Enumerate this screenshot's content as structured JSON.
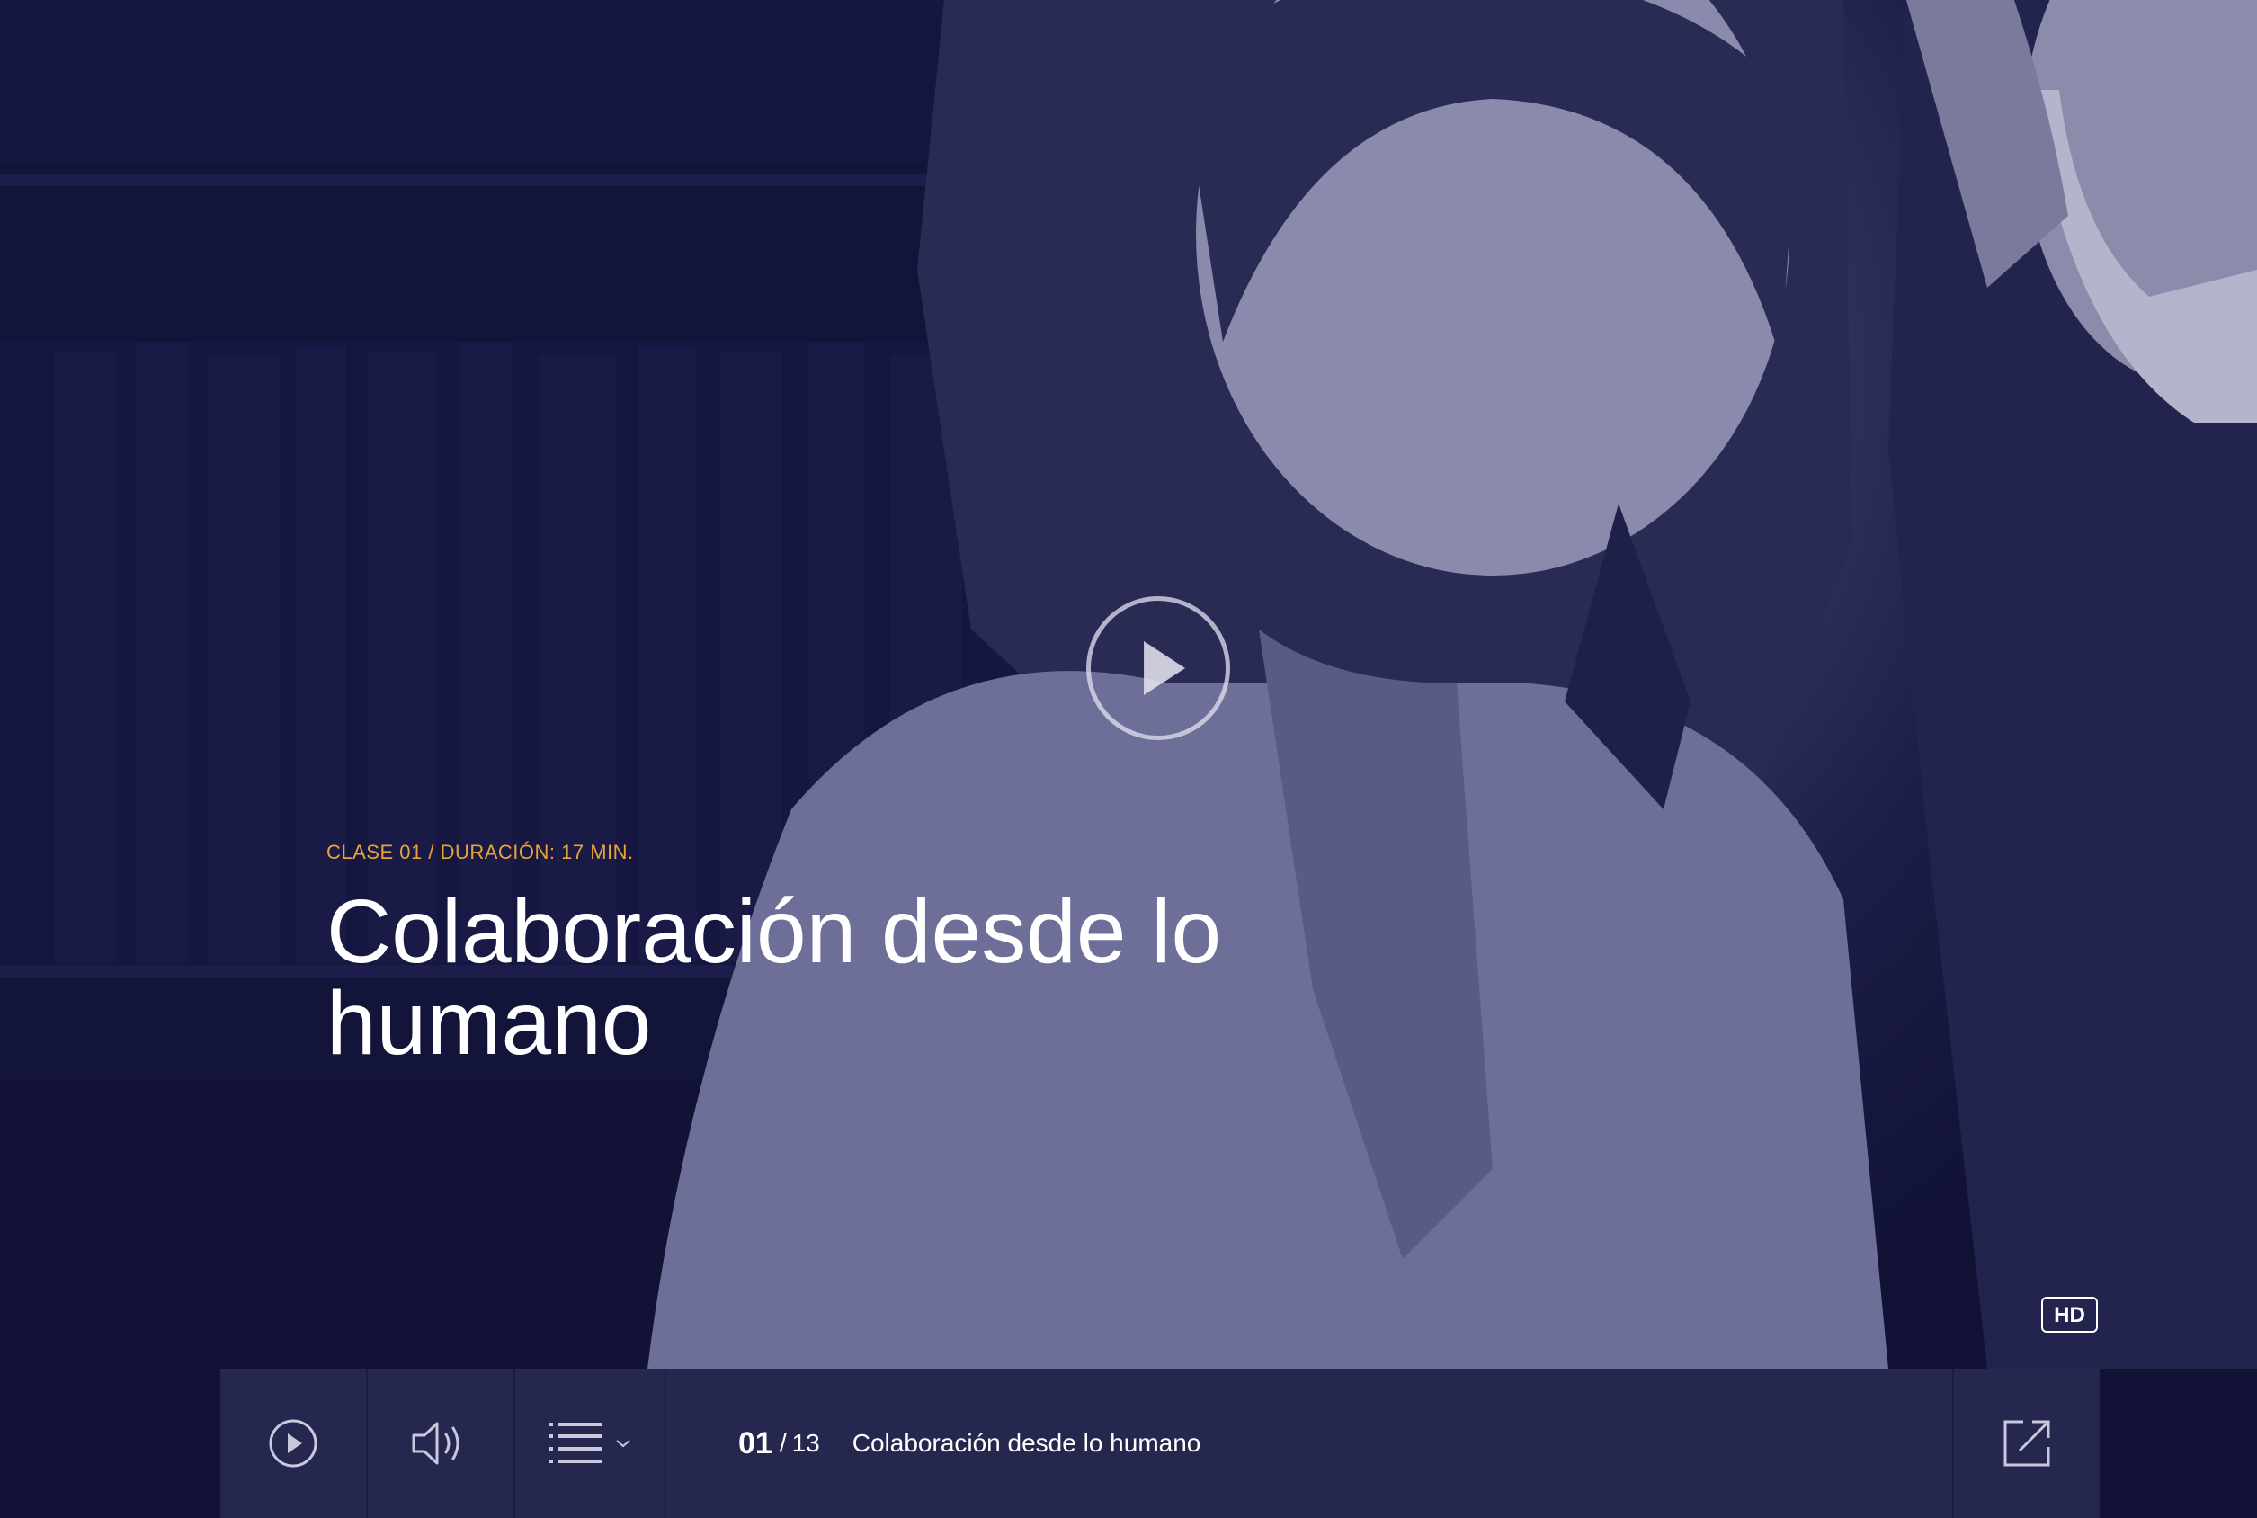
{
  "video": {
    "meta": "CLASE 01 / DURACIÓN: 17 MIN.",
    "title": "Colaboración desde lo humano",
    "quality_badge": "HD"
  },
  "controls": {
    "icons": [
      "play-icon",
      "volume-icon",
      "playlist-icon",
      "chevron-down-icon",
      "external-link-icon"
    ],
    "current": "01",
    "separator": "/",
    "total": "13",
    "episode_title": "Colaboración desde lo humano"
  },
  "colors": {
    "background": "#0f1035",
    "accent": "#e8a23c",
    "bar": "#26274f",
    "text": "#ffffff"
  }
}
